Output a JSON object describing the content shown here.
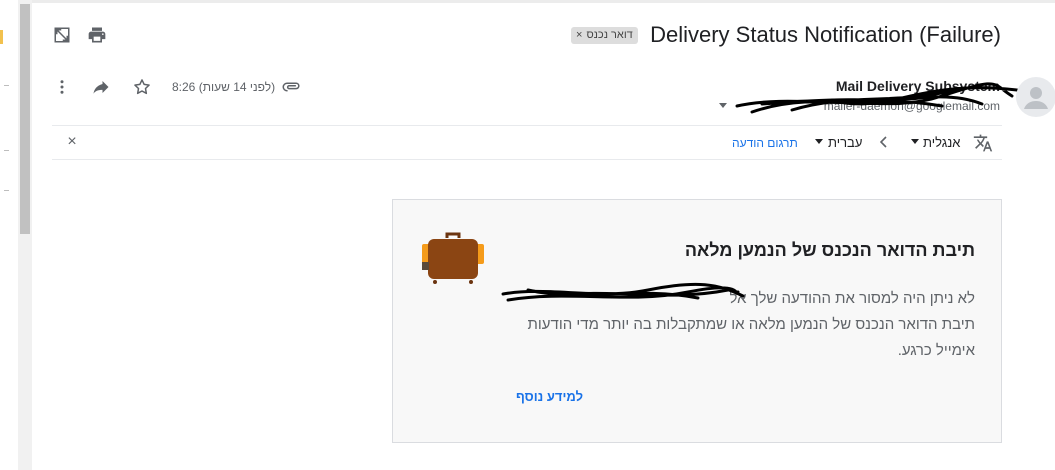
{
  "email": {
    "subject": "Delivery Status Notification (Failure)",
    "label_chip": "דואר נכנס",
    "label_remove": "×",
    "sender_name": "Mail Delivery Subsystem",
    "sender_email": "mailer-daemon@googlemail.com",
    "time": "8:26 (לפני 14 שעות)"
  },
  "translate_bar": {
    "from_language": "אנגלית",
    "to_language": "עברית",
    "translate_link": "תרגום הודעה",
    "close": "×"
  },
  "card": {
    "title": "תיבת הדואר הנכנס של הנמען מלאה",
    "body_line1": "לא ניתן היה למסור את ההודעה שלך אל",
    "body_line2": "תיבת הדואר הנכנס של הנמען מלאה או שמתקבלות בה יותר מדי הודעות אימייל כרגע.",
    "learn_more": "למידע נוסף"
  },
  "icons": {
    "open_in_new_window": "open-in-new-window-icon",
    "print": "print-icon",
    "more": "more-vert-icon",
    "forward": "forward-icon",
    "star": "star-icon",
    "attachment": "paperclip-icon",
    "translate": "translate-icon",
    "avatar": "person-icon",
    "suitcase": "suitcase-icon"
  },
  "colors": {
    "accent_link": "#1a73e8",
    "card_background": "#f8f8f8",
    "suitcase": "#8b4513",
    "suitcase_straps": "#f59b1a"
  }
}
